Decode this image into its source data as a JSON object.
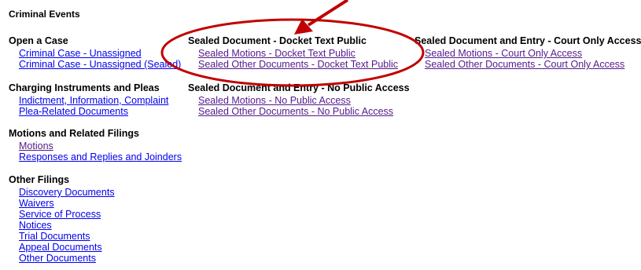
{
  "page_title": "Criminal Events",
  "groups": {
    "open_case": {
      "title": "Open a Case",
      "links": [
        "Criminal Case - Unassigned",
        "Criminal Case - Unassigned (Sealed)"
      ]
    },
    "charging": {
      "title": "Charging Instruments and Pleas",
      "links": [
        "Indictment, Information, Complaint",
        "Plea-Related Documents"
      ]
    },
    "motions": {
      "title": "Motions and Related Filings",
      "links": [
        "Motions",
        "Responses and Replies and Joinders"
      ]
    },
    "other": {
      "title": "Other Filings",
      "links": [
        "Discovery Documents",
        "Waivers",
        "Service of Process",
        "Notices",
        "Trial Documents",
        "Appeal Documents",
        "Other Documents"
      ]
    },
    "sealed_public": {
      "title": "Sealed Document - Docket Text Public",
      "links": [
        "Sealed Motions - Docket Text Public",
        "Sealed Other Documents - Docket Text Public"
      ]
    },
    "sealed_no_public": {
      "title": "Sealed Document and Entry - No Public Access",
      "links": [
        "Sealed Motions - No Public Access",
        "Sealed Other Documents - No Public Access"
      ]
    },
    "sealed_court_only": {
      "title": "Sealed Document and Entry - Court Only Access",
      "links": [
        "Sealed Motions - Court Only Access",
        "Sealed Other Documents - Court Only Access"
      ]
    }
  },
  "colors": {
    "link_unvisited": "#0000ee",
    "link_visited": "#551a8b",
    "annotation": "#c00000"
  }
}
